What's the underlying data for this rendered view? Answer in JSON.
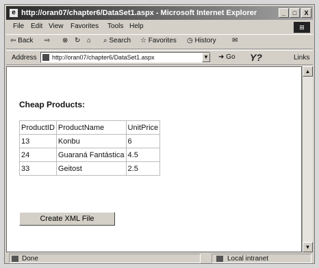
{
  "window": {
    "title": "http://oran07/chapter6/DataSet1.aspx - Microsoft Internet Explorer",
    "minimize_glyph": "_",
    "maximize_glyph": "□",
    "close_glyph": "X"
  },
  "menu": [
    "File",
    "Edit",
    "View",
    "Favorites",
    "Tools",
    "Help"
  ],
  "toolbar": {
    "back": "⇦ Back",
    "forward": "⇨",
    "stop": "⊗",
    "refresh": "↻",
    "home": "⌂",
    "search": "Search",
    "favorites": "Favorites",
    "history": "History",
    "mail": "✉"
  },
  "address": {
    "label": "Address",
    "value": "http://oran07/chapter6/DataSet1.aspx",
    "go": "Go",
    "yahoo": "Y?",
    "links": "Links"
  },
  "content": {
    "heading": "Cheap Products:",
    "columns": [
      "ProductID",
      "ProductName",
      "UnitPrice"
    ],
    "rows": [
      [
        "13",
        "Konbu",
        "6"
      ],
      [
        "24",
        "Guaraná Fantástica",
        "4.5"
      ],
      [
        "33",
        "Geitost",
        "2.5"
      ]
    ],
    "button": "Create XML File"
  },
  "status": {
    "left": "Done",
    "right": "Local intranet"
  }
}
